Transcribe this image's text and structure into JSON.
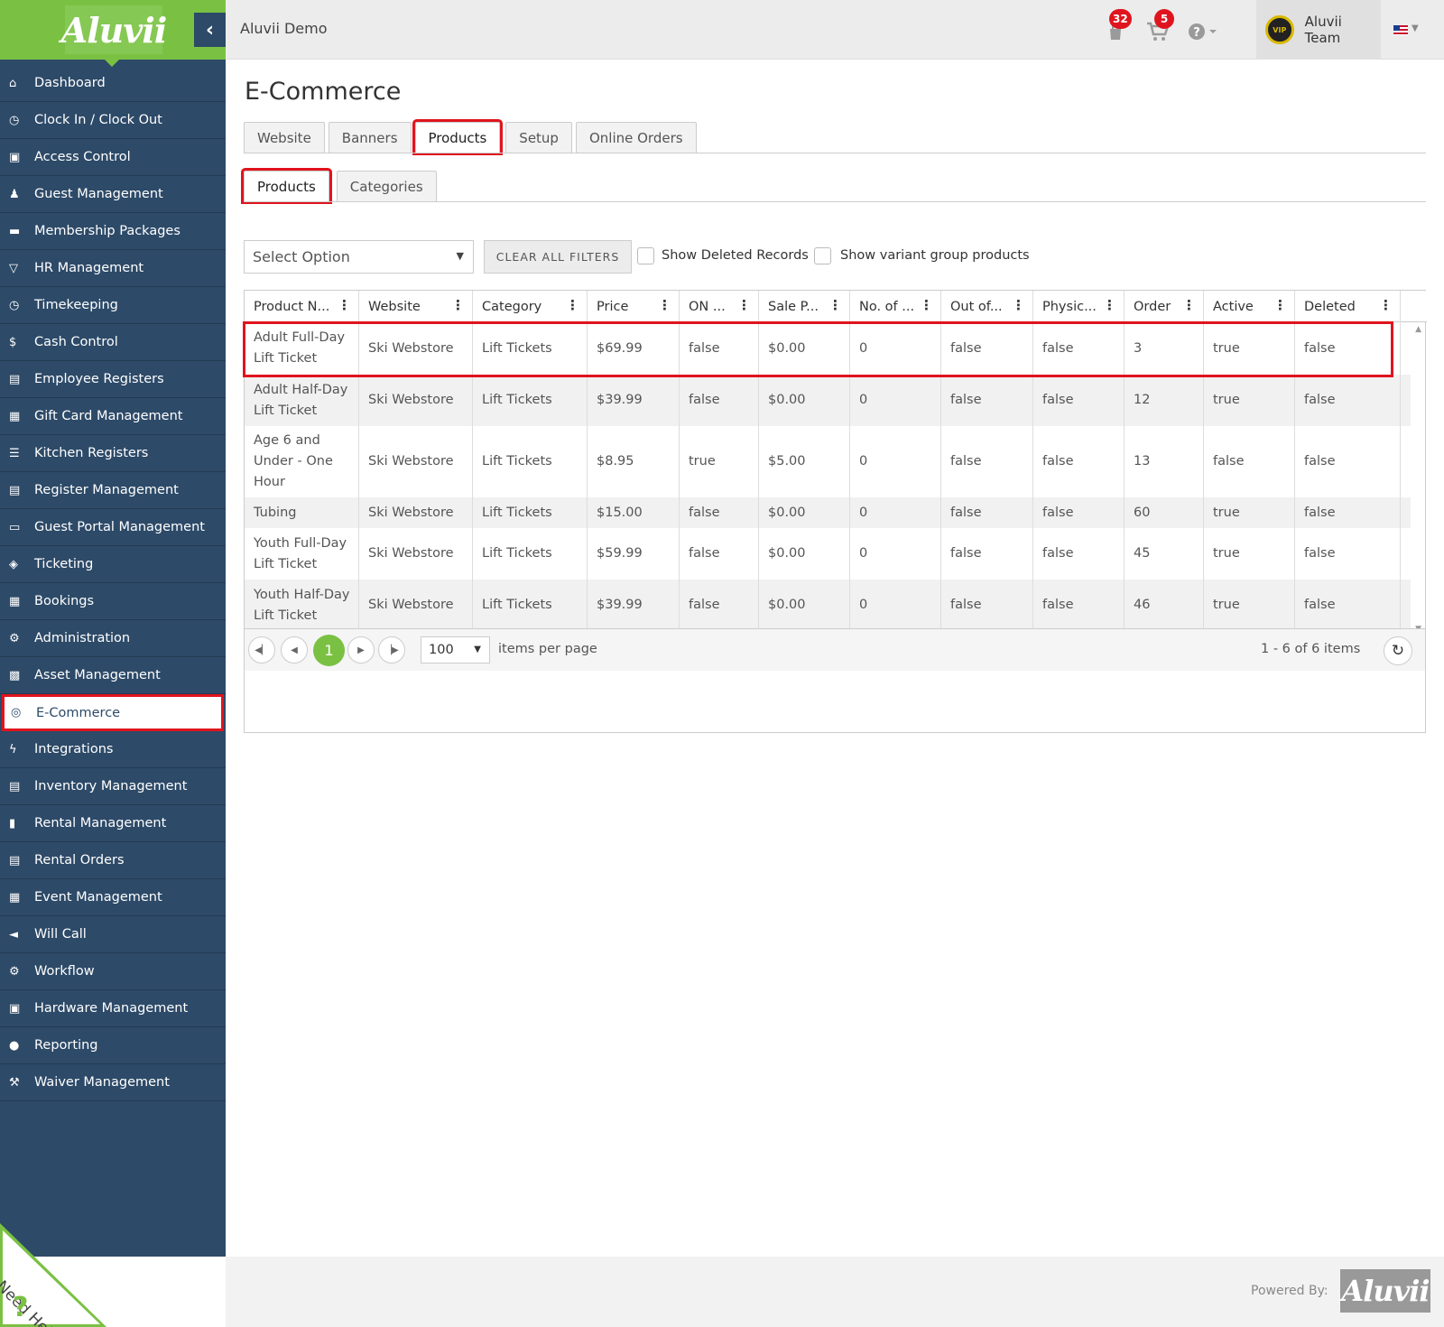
{
  "brand": {
    "logo_text": "Aluvii",
    "accent_color": "#7ac143",
    "sidebar_color": "#2d4a68",
    "highlight_color": "#e0141e"
  },
  "header": {
    "app_title": "Aluvii Demo",
    "notifications_badge": "32",
    "cart_badge": "5",
    "user_name": "Aluvii Team",
    "avatar_text": "VIP",
    "icons": {
      "notifications": "bag-icon",
      "cart": "cart-icon",
      "help": "help-circle-icon",
      "language": "us-flag-icon"
    }
  },
  "sidebar": {
    "items": [
      {
        "label": "Dashboard",
        "icon": "home-icon"
      },
      {
        "label": "Clock In / Clock Out",
        "icon": "clock-icon"
      },
      {
        "label": "Access Control",
        "icon": "lock-icon"
      },
      {
        "label": "Guest Management",
        "icon": "users-icon"
      },
      {
        "label": "Membership Packages",
        "icon": "credit-card-icon"
      },
      {
        "label": "HR Management",
        "icon": "glass-icon"
      },
      {
        "label": "Timekeeping",
        "icon": "clock-icon"
      },
      {
        "label": "Cash Control",
        "icon": "dollar-icon"
      },
      {
        "label": "Employee Registers",
        "icon": "cart-icon"
      },
      {
        "label": "Gift Card Management",
        "icon": "gift-icon"
      },
      {
        "label": "Kitchen Registers",
        "icon": "list-icon"
      },
      {
        "label": "Register Management",
        "icon": "cart-icon"
      },
      {
        "label": "Guest Portal Management",
        "icon": "laptop-icon"
      },
      {
        "label": "Ticketing",
        "icon": "tag-icon"
      },
      {
        "label": "Bookings",
        "icon": "calendar-icon"
      },
      {
        "label": "Administration",
        "icon": "cogs-icon"
      },
      {
        "label": "Asset Management",
        "icon": "cubes-icon"
      },
      {
        "label": "E-Commerce",
        "icon": "globe-icon",
        "active": true
      },
      {
        "label": "Integrations",
        "icon": "bolt-icon"
      },
      {
        "label": "Inventory Management",
        "icon": "archive-icon"
      },
      {
        "label": "Rental Management",
        "icon": "clipboard-icon"
      },
      {
        "label": "Rental Orders",
        "icon": "file-icon"
      },
      {
        "label": "Event Management",
        "icon": "calendar-check-icon"
      },
      {
        "label": "Will Call",
        "icon": "bullhorn-icon"
      },
      {
        "label": "Workflow",
        "icon": "gear-icon"
      },
      {
        "label": "Hardware Management",
        "icon": "print-icon"
      },
      {
        "label": "Reporting",
        "icon": "lightbulb-icon"
      },
      {
        "label": "Waiver Management",
        "icon": "gavel-icon"
      }
    ]
  },
  "need_help": {
    "label": "Need Help",
    "icon_glyph": "?"
  },
  "main": {
    "title": "E-Commerce",
    "tabs": [
      {
        "label": "Website"
      },
      {
        "label": "Banners"
      },
      {
        "label": "Products",
        "active": true
      },
      {
        "label": "Setup"
      },
      {
        "label": "Online Orders"
      }
    ],
    "subtabs": [
      {
        "label": "Products",
        "active": true
      },
      {
        "label": "Categories"
      }
    ],
    "filters": {
      "select_placeholder": "Select Option",
      "clear_label": "CLEAR ALL FILTERS",
      "show_deleted_label": "Show Deleted Records",
      "show_deleted_checked": false,
      "show_variant_label": "Show variant group products",
      "show_variant_checked": false
    },
    "grid": {
      "columns": [
        "Product N...",
        "Website",
        "Category",
        "Price",
        "ON ...",
        "Sale P...",
        "No. of ...",
        "Out of...",
        "Physic...",
        "Order",
        "Active",
        "Deleted"
      ],
      "rows": [
        [
          "Adult Full-Day Lift Ticket",
          "Ski Webstore",
          "Lift Tickets",
          "$69.99",
          "false",
          "$0.00",
          "0",
          "false",
          "false",
          "3",
          "true",
          "false"
        ],
        [
          "Adult Half-Day Lift Ticket",
          "Ski Webstore",
          "Lift Tickets",
          "$39.99",
          "false",
          "$0.00",
          "0",
          "false",
          "false",
          "12",
          "true",
          "false"
        ],
        [
          "Age 6 and Under - One Hour",
          "Ski Webstore",
          "Lift Tickets",
          "$8.95",
          "true",
          "$5.00",
          "0",
          "false",
          "false",
          "13",
          "false",
          "false"
        ],
        [
          "Tubing",
          "Ski Webstore",
          "Lift Tickets",
          "$15.00",
          "false",
          "$0.00",
          "0",
          "false",
          "false",
          "60",
          "true",
          "false"
        ],
        [
          "Youth Full-Day Lift Ticket",
          "Ski Webstore",
          "Lift Tickets",
          "$59.99",
          "false",
          "$0.00",
          "0",
          "false",
          "false",
          "45",
          "true",
          "false"
        ],
        [
          "Youth Half-Day Lift Ticket",
          "Ski Webstore",
          "Lift Tickets",
          "$39.99",
          "false",
          "$0.00",
          "0",
          "false",
          "false",
          "46",
          "true",
          "false"
        ]
      ],
      "pager": {
        "current_page": "1",
        "page_size": "100",
        "per_page_label": "items per page",
        "info": "1 - 6 of 6 items"
      }
    }
  },
  "footer": {
    "powered_by": "Powered By:",
    "logo_text": "Aluvii"
  }
}
